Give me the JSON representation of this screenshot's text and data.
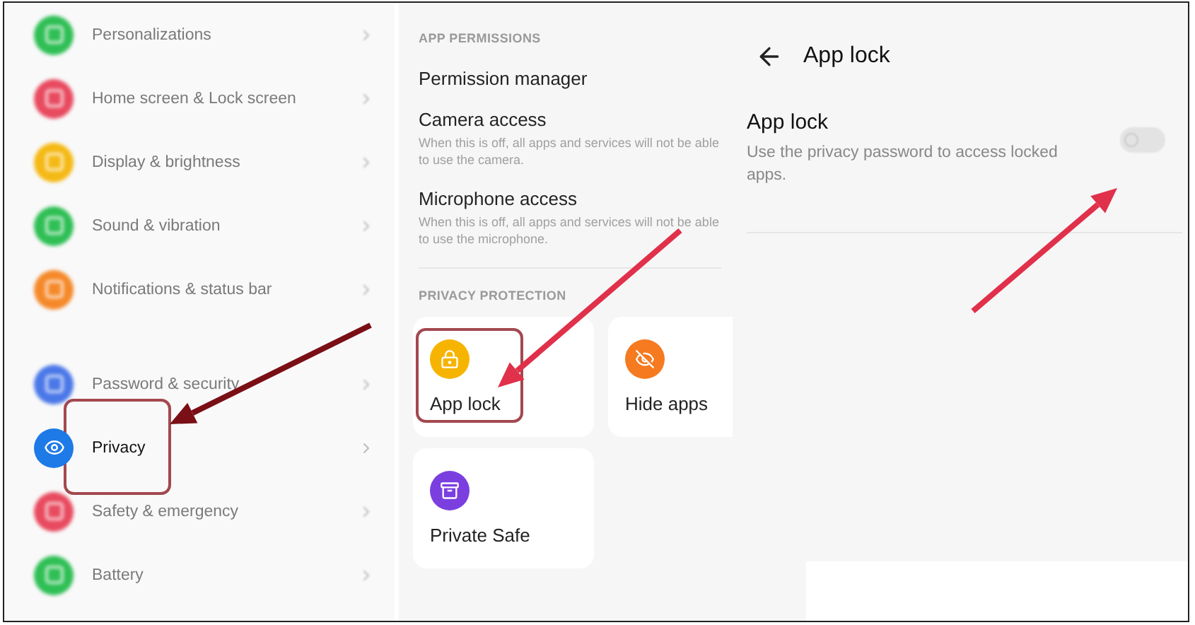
{
  "settings_list": {
    "items": [
      {
        "label": "Personalizations",
        "color": "#2fbf55",
        "blurred": true,
        "highlighted": false,
        "gap_before": false
      },
      {
        "label": "Home screen & Lock screen",
        "color": "#e84a5f",
        "blurred": true,
        "highlighted": false,
        "gap_before": false
      },
      {
        "label": "Display & brightness",
        "color": "#f5b915",
        "blurred": true,
        "highlighted": false,
        "gap_before": false
      },
      {
        "label": "Sound & vibration",
        "color": "#2fbf55",
        "blurred": true,
        "highlighted": false,
        "gap_before": false
      },
      {
        "label": "Notifications & status bar",
        "color": "#f5892a",
        "blurred": true,
        "highlighted": false,
        "gap_before": false
      },
      {
        "label": "Password & security",
        "color": "#4a78e8",
        "blurred": true,
        "highlighted": false,
        "gap_before": true
      },
      {
        "label": "Privacy",
        "color": "#1e7ae6",
        "blurred": false,
        "highlighted": true,
        "gap_before": false
      },
      {
        "label": "Safety & emergency",
        "color": "#e84a5f",
        "blurred": true,
        "highlighted": false,
        "gap_before": false
      },
      {
        "label": "Battery",
        "color": "#2fbf55",
        "blurred": true,
        "highlighted": false,
        "gap_before": false
      }
    ]
  },
  "privacy": {
    "permissions_header": "APP PERMISSIONS",
    "permissions": [
      {
        "title": "Permission manager"
      },
      {
        "title": "Camera access",
        "description": "When this is off, all apps and services will not be able to use the camera."
      },
      {
        "title": "Microphone access",
        "description": "When this is off, all apps and services will not be able to use the microphone."
      }
    ],
    "protection_header": "PRIVACY PROTECTION",
    "cards": [
      {
        "label": "App lock",
        "color": "#f6b400",
        "highlighted": true
      },
      {
        "label": "Hide apps",
        "color": "#f57a20",
        "highlighted": false
      },
      {
        "label": "Private Safe",
        "color": "#7b3fe0",
        "highlighted": false
      }
    ]
  },
  "app_lock": {
    "title": "App lock",
    "setting": {
      "title": "App lock",
      "description": "Use the privacy password to access locked apps.",
      "on": false
    }
  }
}
